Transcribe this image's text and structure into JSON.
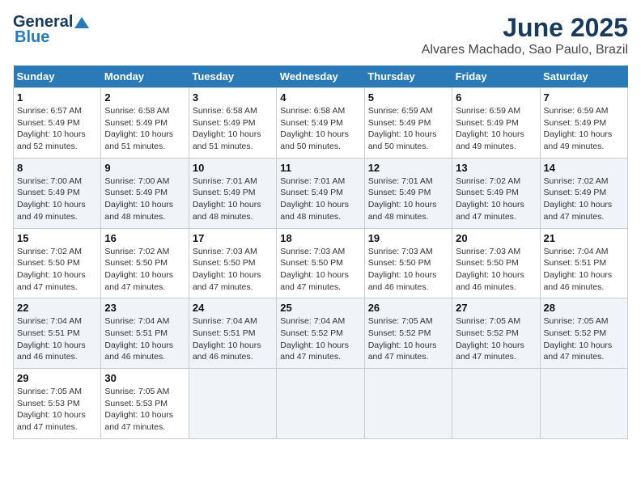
{
  "header": {
    "logo_line1": "General",
    "logo_line2": "Blue",
    "month_title": "June 2025",
    "location": "Alvares Machado, Sao Paulo, Brazil"
  },
  "days_of_week": [
    "Sunday",
    "Monday",
    "Tuesday",
    "Wednesday",
    "Thursday",
    "Friday",
    "Saturday"
  ],
  "weeks": [
    [
      {
        "day": "1",
        "text": "Sunrise: 6:57 AM\nSunset: 5:49 PM\nDaylight: 10 hours\nand 52 minutes."
      },
      {
        "day": "2",
        "text": "Sunrise: 6:58 AM\nSunset: 5:49 PM\nDaylight: 10 hours\nand 51 minutes."
      },
      {
        "day": "3",
        "text": "Sunrise: 6:58 AM\nSunset: 5:49 PM\nDaylight: 10 hours\nand 51 minutes."
      },
      {
        "day": "4",
        "text": "Sunrise: 6:58 AM\nSunset: 5:49 PM\nDaylight: 10 hours\nand 50 minutes."
      },
      {
        "day": "5",
        "text": "Sunrise: 6:59 AM\nSunset: 5:49 PM\nDaylight: 10 hours\nand 50 minutes."
      },
      {
        "day": "6",
        "text": "Sunrise: 6:59 AM\nSunset: 5:49 PM\nDaylight: 10 hours\nand 49 minutes."
      },
      {
        "day": "7",
        "text": "Sunrise: 6:59 AM\nSunset: 5:49 PM\nDaylight: 10 hours\nand 49 minutes."
      }
    ],
    [
      {
        "day": "8",
        "text": "Sunrise: 7:00 AM\nSunset: 5:49 PM\nDaylight: 10 hours\nand 49 minutes."
      },
      {
        "day": "9",
        "text": "Sunrise: 7:00 AM\nSunset: 5:49 PM\nDaylight: 10 hours\nand 48 minutes."
      },
      {
        "day": "10",
        "text": "Sunrise: 7:01 AM\nSunset: 5:49 PM\nDaylight: 10 hours\nand 48 minutes."
      },
      {
        "day": "11",
        "text": "Sunrise: 7:01 AM\nSunset: 5:49 PM\nDaylight: 10 hours\nand 48 minutes."
      },
      {
        "day": "12",
        "text": "Sunrise: 7:01 AM\nSunset: 5:49 PM\nDaylight: 10 hours\nand 48 minutes."
      },
      {
        "day": "13",
        "text": "Sunrise: 7:02 AM\nSunset: 5:49 PM\nDaylight: 10 hours\nand 47 minutes."
      },
      {
        "day": "14",
        "text": "Sunrise: 7:02 AM\nSunset: 5:49 PM\nDaylight: 10 hours\nand 47 minutes."
      }
    ],
    [
      {
        "day": "15",
        "text": "Sunrise: 7:02 AM\nSunset: 5:50 PM\nDaylight: 10 hours\nand 47 minutes."
      },
      {
        "day": "16",
        "text": "Sunrise: 7:02 AM\nSunset: 5:50 PM\nDaylight: 10 hours\nand 47 minutes."
      },
      {
        "day": "17",
        "text": "Sunrise: 7:03 AM\nSunset: 5:50 PM\nDaylight: 10 hours\nand 47 minutes."
      },
      {
        "day": "18",
        "text": "Sunrise: 7:03 AM\nSunset: 5:50 PM\nDaylight: 10 hours\nand 47 minutes."
      },
      {
        "day": "19",
        "text": "Sunrise: 7:03 AM\nSunset: 5:50 PM\nDaylight: 10 hours\nand 46 minutes."
      },
      {
        "day": "20",
        "text": "Sunrise: 7:03 AM\nSunset: 5:50 PM\nDaylight: 10 hours\nand 46 minutes."
      },
      {
        "day": "21",
        "text": "Sunrise: 7:04 AM\nSunset: 5:51 PM\nDaylight: 10 hours\nand 46 minutes."
      }
    ],
    [
      {
        "day": "22",
        "text": "Sunrise: 7:04 AM\nSunset: 5:51 PM\nDaylight: 10 hours\nand 46 minutes."
      },
      {
        "day": "23",
        "text": "Sunrise: 7:04 AM\nSunset: 5:51 PM\nDaylight: 10 hours\nand 46 minutes."
      },
      {
        "day": "24",
        "text": "Sunrise: 7:04 AM\nSunset: 5:51 PM\nDaylight: 10 hours\nand 46 minutes."
      },
      {
        "day": "25",
        "text": "Sunrise: 7:04 AM\nSunset: 5:52 PM\nDaylight: 10 hours\nand 47 minutes."
      },
      {
        "day": "26",
        "text": "Sunrise: 7:05 AM\nSunset: 5:52 PM\nDaylight: 10 hours\nand 47 minutes."
      },
      {
        "day": "27",
        "text": "Sunrise: 7:05 AM\nSunset: 5:52 PM\nDaylight: 10 hours\nand 47 minutes."
      },
      {
        "day": "28",
        "text": "Sunrise: 7:05 AM\nSunset: 5:52 PM\nDaylight: 10 hours\nand 47 minutes."
      }
    ],
    [
      {
        "day": "29",
        "text": "Sunrise: 7:05 AM\nSunset: 5:53 PM\nDaylight: 10 hours\nand 47 minutes."
      },
      {
        "day": "30",
        "text": "Sunrise: 7:05 AM\nSunset: 5:53 PM\nDaylight: 10 hours\nand 47 minutes."
      },
      {
        "day": "",
        "text": ""
      },
      {
        "day": "",
        "text": ""
      },
      {
        "day": "",
        "text": ""
      },
      {
        "day": "",
        "text": ""
      },
      {
        "day": "",
        "text": ""
      }
    ]
  ]
}
